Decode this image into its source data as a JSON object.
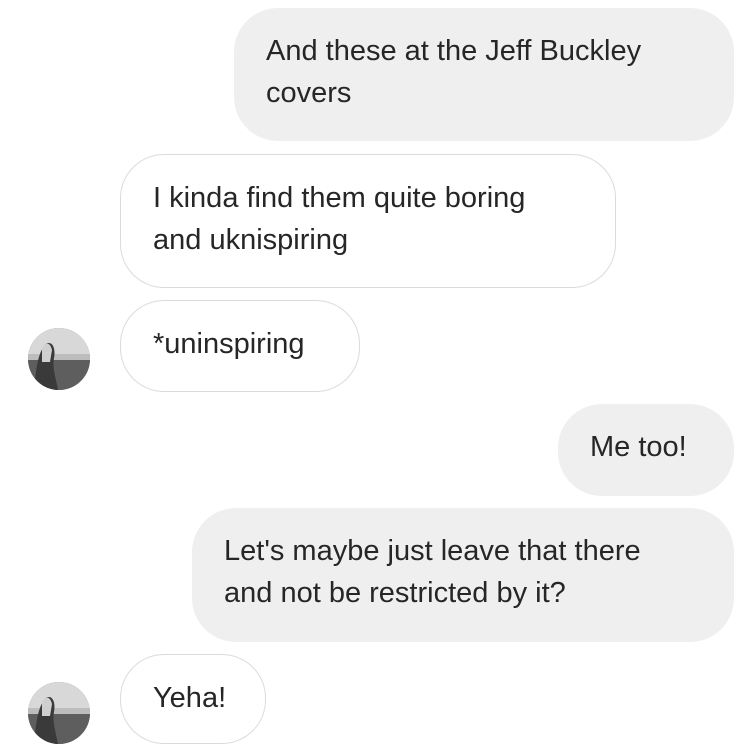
{
  "conversation": {
    "messages": [
      {
        "sender": "me",
        "lines": [
          "And these at the Jeff Buckley",
          "covers"
        ]
      },
      {
        "sender": "them",
        "lines": [
          "I kinda find them quite boring",
          "and uknispiring"
        ]
      },
      {
        "sender": "them",
        "lines": [
          "*uninspiring"
        ]
      },
      {
        "sender": "me",
        "lines": [
          "Me too!"
        ]
      },
      {
        "sender": "me",
        "lines": [
          "Let's maybe just leave that there",
          "and not be restricted by it?"
        ]
      },
      {
        "sender": "them",
        "lines": [
          "Yeha!"
        ]
      }
    ],
    "avatar_icon": "contact-profile-photo",
    "colors": {
      "outgoing_bubble": "#efefef",
      "incoming_bubble": "#ffffff",
      "incoming_border": "#dbdbdb",
      "text": "#262626"
    }
  }
}
